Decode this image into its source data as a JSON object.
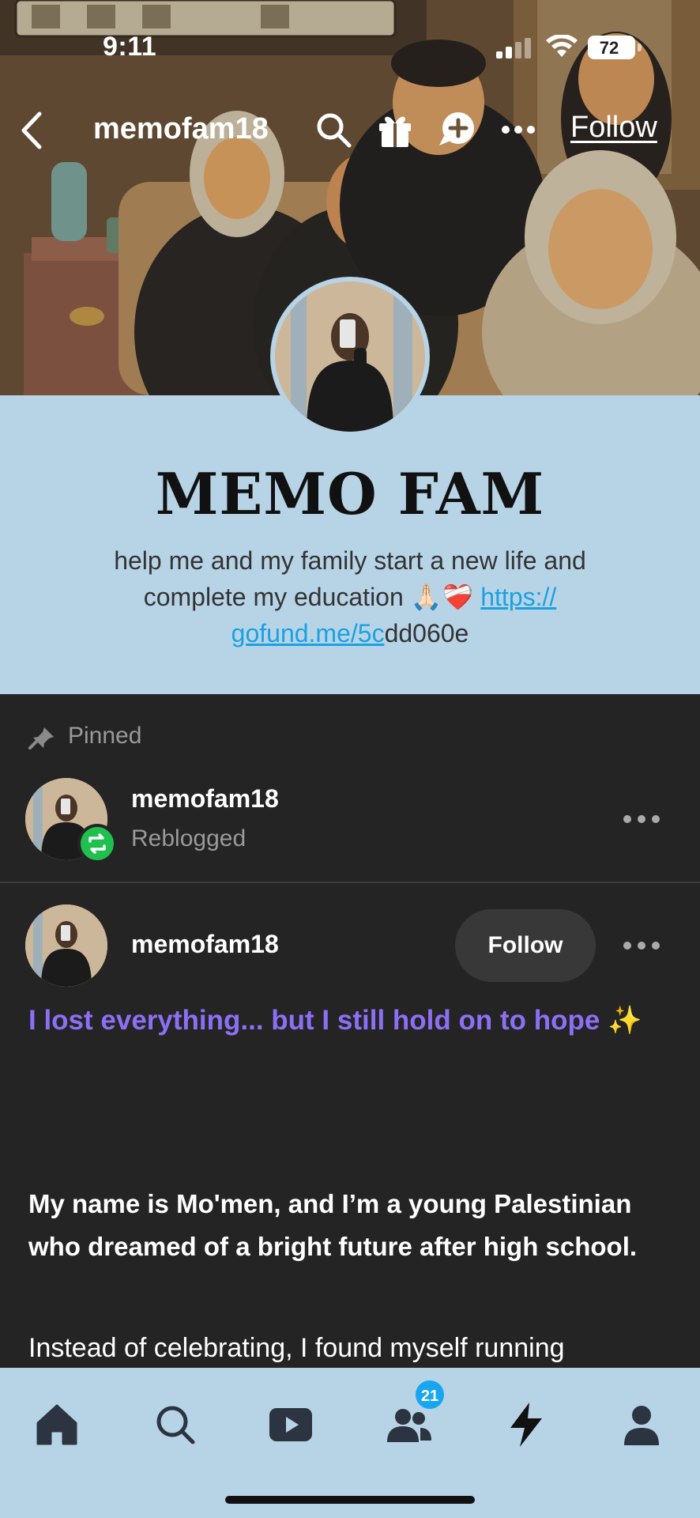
{
  "status_bar": {
    "time": "9:11",
    "battery": "72"
  },
  "topnav": {
    "username": "memofam18",
    "follow_label": "Follow",
    "icons": [
      "back-chevron-icon",
      "search-icon",
      "gift-icon",
      "chat-add-icon",
      "more-dots-icon"
    ]
  },
  "profile": {
    "title": "MEMO FAM",
    "description_line1": "help me and my family start a new life and",
    "description_line2": "complete my education 🙏🏻❤️‍🩹 ",
    "link_part1": "https://",
    "link_part2": "gofund.me/5c",
    "link_suffix": "dd060e"
  },
  "feed": {
    "pinned_label": "Pinned",
    "reblog_item": {
      "username": "memofam18",
      "sub": "Reblogged"
    },
    "post": {
      "username": "memofam18",
      "follow_label": "Follow",
      "headline": "I lost everything... but I still hold on to hope ✨",
      "bold_paragraph": "My name is Mo'men, and I’m a young Palestinian who dreamed of a bright future after high school.",
      "text": "Instead of celebrating, I found myself running"
    }
  },
  "tabbar": {
    "tabs": [
      "home-icon",
      "search-icon",
      "video-icon",
      "community-icon",
      "activity-icon",
      "account-icon"
    ],
    "community_badge": "21"
  },
  "colors": {
    "accent_blue": "#b7d4e7",
    "headline_purple": "#8d6ff6",
    "link_blue": "#1ba1e2",
    "reblog_green": "#1fc04e",
    "feed_bg": "#242424"
  }
}
